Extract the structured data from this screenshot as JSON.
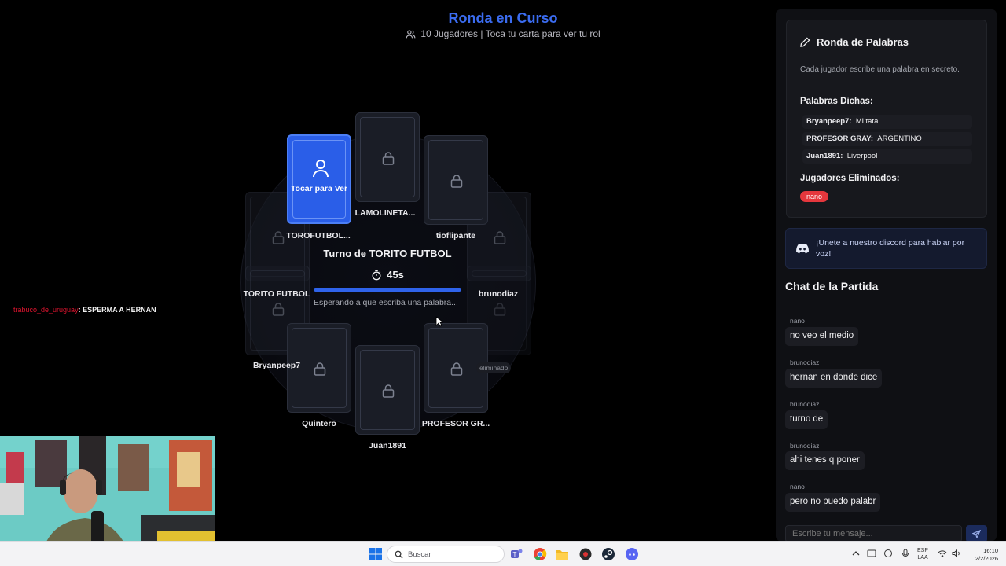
{
  "header": {
    "title": "Ronda en Curso",
    "subtitle": "10 Jugadores | Toca tu carta para ver tu rol"
  },
  "table": {
    "my_card_label": "Tocar para Ver",
    "turn_title": "Turno de TORITO FUTBOL",
    "timer": "45s",
    "timer_progress": 1.0,
    "waiting_text": "Esperando a que escriba una palabra...",
    "players": [
      "TORITO FUTBOL",
      "TOROFUTBOL...",
      "LAMOLINETA...",
      "tioflipante",
      "brunodiaz",
      "Bryanpeep7",
      "Quintero",
      "Juan1891",
      "PROFESOR GR...",
      "eliminado"
    ]
  },
  "stream_overlay": {
    "user": "trabuco_de_uruguay",
    "message": ": ESPERMA A HERNAN"
  },
  "words_card": {
    "title": "Ronda de Palabras",
    "description": "Cada jugador escribe una palabra en secreto.",
    "said_heading": "Palabras Dichas:",
    "words": [
      {
        "player": "Bryanpeep7:",
        "word": "Mi tata"
      },
      {
        "player": "PROFESOR GRAY:",
        "word": "ARGENTINO"
      },
      {
        "player": "Juan1891:",
        "word": "Liverpool"
      }
    ],
    "eliminated_heading": "Jugadores Eliminados:",
    "eliminated": [
      "nano"
    ]
  },
  "discord": {
    "text": "¡Unete a nuestro discord para hablar por voz!"
  },
  "chat": {
    "title": "Chat de la Partida",
    "messages": [
      {
        "user": "nano",
        "text": "no veo el medio"
      },
      {
        "user": "brunodiaz",
        "text": "hernan en donde dice"
      },
      {
        "user": "brunodiaz",
        "text": "turno de"
      },
      {
        "user": "brunodiaz",
        "text": "ahi tenes q poner"
      },
      {
        "user": "nano",
        "text": "pero no puedo palabr"
      }
    ],
    "input_placeholder": "Escribe tu mensaje..."
  },
  "taskbar": {
    "search_placeholder": "Buscar",
    "lang_line1": "ESP",
    "lang_line2": "LAA",
    "time": "16:10",
    "date": "2/2/2026"
  },
  "colors": {
    "accent": "#2f63ea",
    "title": "#3b6cf0",
    "danger": "#e5373d",
    "overlay_user": "#e0142f"
  }
}
